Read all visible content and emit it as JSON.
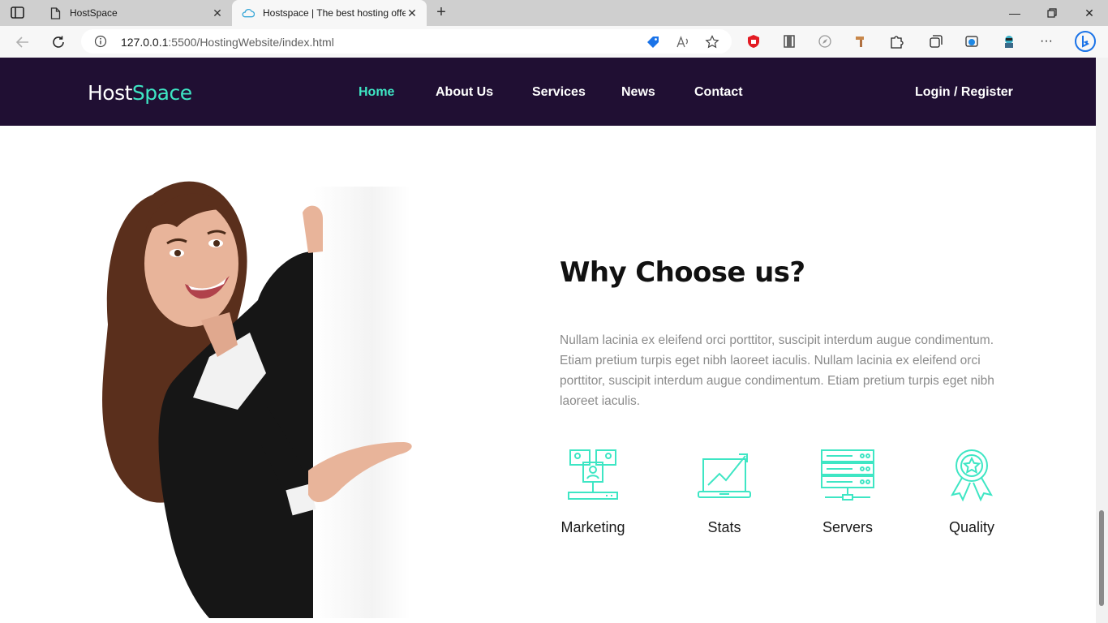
{
  "browser": {
    "tabs": [
      {
        "title": "HostSpace"
      },
      {
        "title": "Hostspace | The best hosting offe"
      }
    ],
    "url_host": "127.0.0.1",
    "url_path": ":5500/HostingWebsite/index.html"
  },
  "site": {
    "logo_main": "Host",
    "logo_accent": "Space",
    "menu": [
      "Home",
      "About Us",
      "Services",
      "News",
      "Contact"
    ],
    "login": "Login / Register",
    "colors": {
      "nav_bg": "#200f33",
      "accent": "#3ee6c4"
    }
  },
  "hero": {
    "heading": "Why Choose us?",
    "paragraph": "Nullam lacinia ex eleifend orci porttitor, suscipit interdum augue condimentum. Etiam pretium turpis eget nibh laoreet iaculis. Nullam lacinia ex eleifend orci porttitor, suscipit interdum augue condimentum. Etiam pretium turpis eget nibh laoreet iaculis.",
    "features": [
      {
        "label": "Marketing",
        "icon": "marketing-icon"
      },
      {
        "label": "Stats",
        "icon": "stats-icon"
      },
      {
        "label": "Servers",
        "icon": "servers-icon"
      },
      {
        "label": "Quality",
        "icon": "quality-icon"
      }
    ]
  }
}
